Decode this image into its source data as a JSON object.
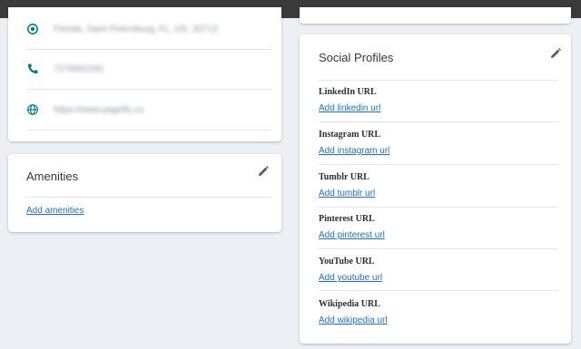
{
  "contact": {
    "address": "Florida, Saint Petersburg, FL, US, 33713",
    "phone": "7278452291",
    "website": "https://www.pagefix.co"
  },
  "amenities": {
    "title": "Amenities",
    "add_label": "Add amenities"
  },
  "social": {
    "title": "Social Profiles",
    "items": [
      {
        "label": "LinkedIn URL",
        "link": "Add linkedin url"
      },
      {
        "label": "Instagram URL",
        "link": "Add instagram url"
      },
      {
        "label": "Tumblr URL",
        "link": "Add tumblr url"
      },
      {
        "label": "Pinterest URL",
        "link": "Add pinterest url"
      },
      {
        "label": "YouTube URL",
        "link": "Add youtube url"
      },
      {
        "label": "Wikipedia URL",
        "link": "Add wikipedia url"
      }
    ]
  },
  "colors": {
    "accent": "#0a7d8c",
    "link": "#1f6fc5",
    "topbar": "#3a3a3a",
    "background": "#eceff3"
  }
}
